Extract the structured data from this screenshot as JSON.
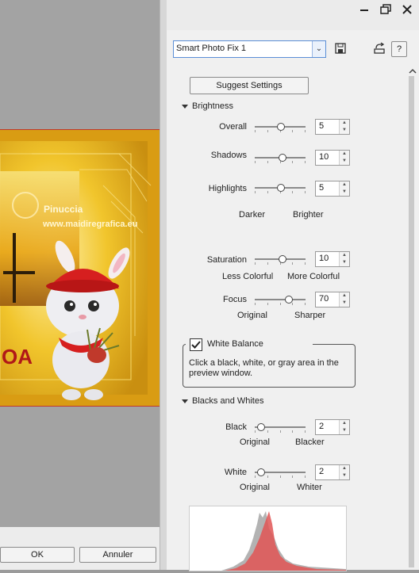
{
  "preview": {
    "watermark": "Pinuccia",
    "watermark_url": "www.maidiregrafica.eu",
    "banner_text": "OA"
  },
  "dialog_buttons": {
    "ok_label": "OK",
    "cancel_label": "Annuler"
  },
  "titlebar": {
    "minimize_icon": "minimize-icon",
    "restore_icon": "restore-icon",
    "close_icon": "close-icon"
  },
  "preset": {
    "selected": "Smart Photo Fix 1"
  },
  "help_label": "?",
  "suggest_label": "Suggest Settings",
  "brightness": {
    "title": "Brightness",
    "overall": {
      "label": "Overall",
      "value": "5",
      "level": 0.52
    },
    "shadows": {
      "label": "Shadows",
      "value": "10",
      "level": 0.55
    },
    "highlights": {
      "label": "Highlights",
      "value": "5",
      "level": 0.52
    },
    "left_caption": "Darker",
    "right_caption": "Brighter"
  },
  "saturation": {
    "label": "Saturation",
    "value": "10",
    "level": 0.55,
    "left_caption": "Less Colorful",
    "right_caption": "More Colorful"
  },
  "focus": {
    "label": "Focus",
    "value": "70",
    "level": 0.7,
    "left_caption": "Original",
    "right_caption": "Sharper"
  },
  "white_balance": {
    "label": "White Balance",
    "checked": true,
    "description": "Click a black, white, or gray area in the preview window."
  },
  "blacks_whites": {
    "title": "Blacks and Whites",
    "black": {
      "label": "Black",
      "value": "2",
      "level": 0.05,
      "left_caption": "Original",
      "right_caption": "Blacker"
    },
    "white": {
      "label": "White",
      "value": "2",
      "level": 0.05,
      "left_caption": "Original",
      "right_caption": "Whiter"
    }
  },
  "colors": {
    "accent_border": "#5a8ed6",
    "preview_frame": "#e8b21c",
    "histogram_red": "#e05555",
    "histogram_gray": "#9a9a9a"
  }
}
